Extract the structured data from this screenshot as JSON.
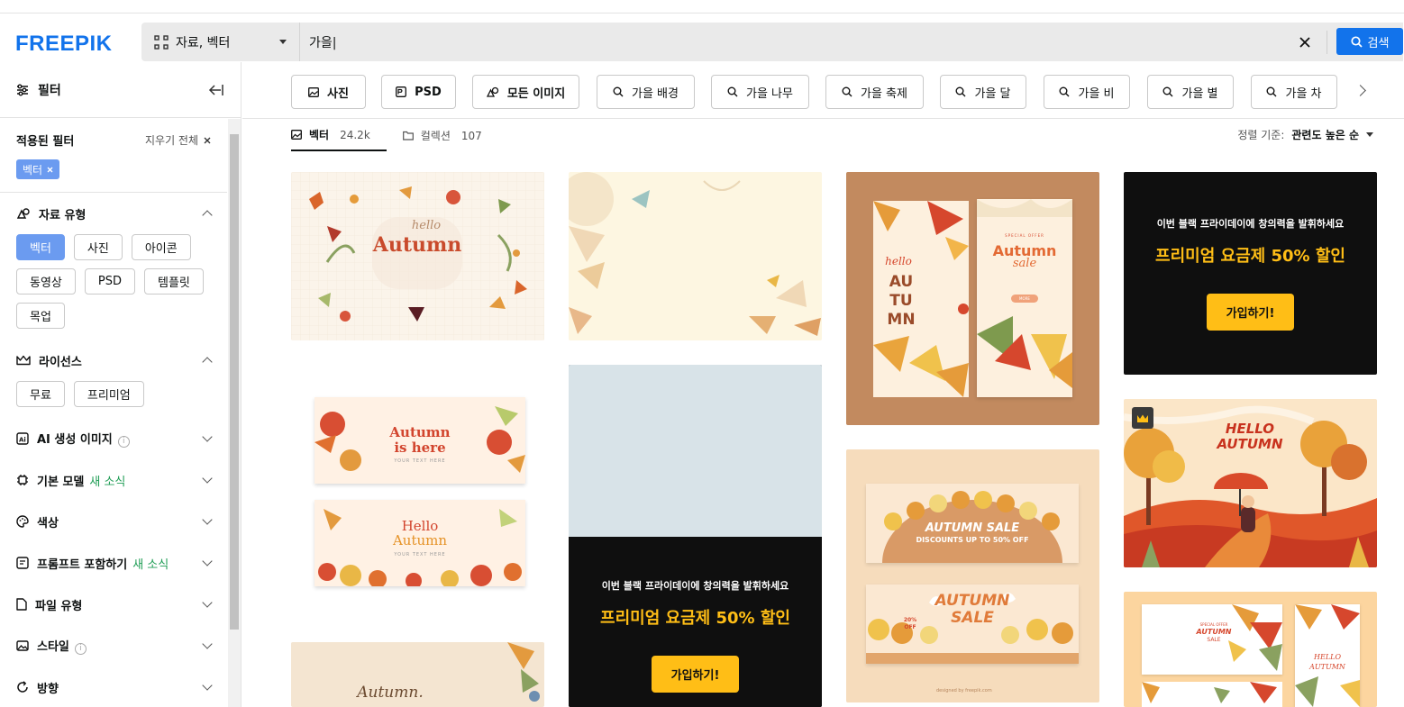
{
  "header": {
    "logo": "FREEPIK",
    "type_select": "자료, 벡터",
    "search_value": "가을|",
    "search_button": "검색"
  },
  "sidebar": {
    "title": "필터",
    "applied_title": "적용된 필터",
    "clear_all": "지우기 전체",
    "applied_chip": "벡터",
    "sections": {
      "asset_type": {
        "title": "자료 유형",
        "options": [
          "벡터",
          "사진",
          "아이콘",
          "동영상",
          "PSD",
          "템플릿",
          "목업"
        ]
      },
      "license": {
        "title": "라이선스",
        "options": [
          "무료",
          "프리미엄"
        ]
      },
      "ai": {
        "title": "AI 생성 이미지"
      },
      "model": {
        "title": "기본 모델",
        "badge": "새 소식"
      },
      "color": {
        "title": "색상"
      },
      "prompt": {
        "title": "프롬프트 포함하기",
        "badge": "새 소식"
      },
      "file_type": {
        "title": "파일 유형"
      },
      "style": {
        "title": "스타일"
      },
      "orientation": {
        "title": "방향"
      }
    }
  },
  "tags": [
    "사진",
    "PSD",
    "모든 이미지",
    "가을 배경",
    "가을 나무",
    "가을 축제",
    "가을 달",
    "가을 비",
    "가을 별",
    "가을 차"
  ],
  "results": {
    "tab_vector": "벡터",
    "tab_vector_count": "24.2k",
    "tab_collection": "컬렉션",
    "tab_collection_count": "107",
    "sort_label": "정렬 기준:",
    "sort_value": "관련도 높은 순"
  },
  "promo": {
    "subtitle": "이번 블랙 프라이데이에 창의력을 발휘하세요",
    "headline": "프리미엄 요금제 50% 할인",
    "cta": "가입하기!"
  },
  "cards": {
    "c1": {
      "small": "hello",
      "big": "Autumn"
    },
    "c3_left": [
      "hello",
      "AU",
      "TU",
      "MN"
    ],
    "c3_right_small": "SPECIAL OFFER",
    "c3_right_big": "Autumn",
    "c3_right_sale": "sale",
    "c3_right_more": "MORE",
    "c5_top": [
      "Autumn",
      "is here"
    ],
    "c5_bottom": [
      "Hello",
      "Autumn"
    ],
    "c5_caption": "YOUR TEXT HERE",
    "c7_top_title": "AUTUMN SALE",
    "c7_top_sub": "DISCOUNTS UP TO 50% OFF",
    "c7_bottom_title": [
      "AUTUMN",
      "SALE"
    ],
    "c7_bottom_badge": [
      "20%",
      "OFF"
    ],
    "c7_credit": "designed by freepik.com",
    "c8_title": [
      "HELLO",
      "AUTUMN"
    ],
    "c9_text": "Autumn.",
    "c10_texts": [
      "SPECIAL OFFER",
      "AUTUMN",
      "SALE",
      "HELLO",
      "AUTUMN"
    ]
  }
}
